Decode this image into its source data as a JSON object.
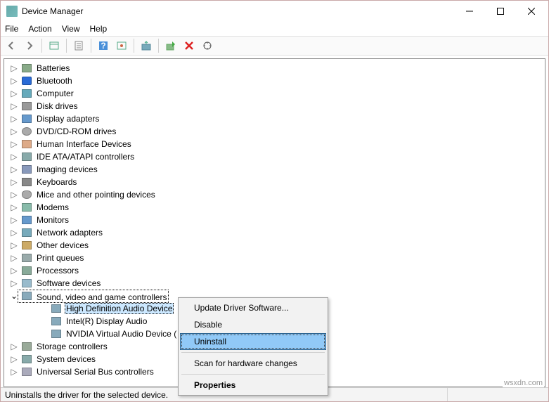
{
  "window": {
    "title": "Device Manager"
  },
  "menu": {
    "file": "File",
    "action": "Action",
    "view": "View",
    "help": "Help"
  },
  "tree": {
    "items": [
      {
        "label": "Batteries",
        "icon": "battery-icon"
      },
      {
        "label": "Bluetooth",
        "icon": "bluetooth-icon"
      },
      {
        "label": "Computer",
        "icon": "computer-icon"
      },
      {
        "label": "Disk drives",
        "icon": "disk-icon"
      },
      {
        "label": "Display adapters",
        "icon": "display-icon"
      },
      {
        "label": "DVD/CD-ROM drives",
        "icon": "dvd-icon"
      },
      {
        "label": "Human Interface Devices",
        "icon": "hid-icon"
      },
      {
        "label": "IDE ATA/ATAPI controllers",
        "icon": "ide-icon"
      },
      {
        "label": "Imaging devices",
        "icon": "imaging-icon"
      },
      {
        "label": "Keyboards",
        "icon": "keyboard-icon"
      },
      {
        "label": "Mice and other pointing devices",
        "icon": "mouse-icon"
      },
      {
        "label": "Modems",
        "icon": "modem-icon"
      },
      {
        "label": "Monitors",
        "icon": "monitor-icon"
      },
      {
        "label": "Network adapters",
        "icon": "network-icon"
      },
      {
        "label": "Other devices",
        "icon": "other-icon"
      },
      {
        "label": "Print queues",
        "icon": "printer-icon"
      },
      {
        "label": "Processors",
        "icon": "cpu-icon"
      },
      {
        "label": "Software devices",
        "icon": "software-icon"
      }
    ],
    "expanded": {
      "label": "Sound, video and game controllers",
      "children": [
        {
          "label": "High Definition Audio Device",
          "selected": true
        },
        {
          "label": "Intel(R) Display Audio"
        },
        {
          "label": "NVIDIA Virtual Audio Device ("
        }
      ]
    },
    "after": [
      {
        "label": "Storage controllers",
        "icon": "storage-icon"
      },
      {
        "label": "System devices",
        "icon": "system-icon"
      },
      {
        "label": "Universal Serial Bus controllers",
        "icon": "usb-icon"
      }
    ]
  },
  "context_menu": {
    "update": "Update Driver Software...",
    "disable": "Disable",
    "uninstall": "Uninstall",
    "scan": "Scan for hardware changes",
    "properties": "Properties"
  },
  "status": {
    "text": "Uninstalls the driver for the selected device."
  },
  "watermark": "wsxdn.com"
}
